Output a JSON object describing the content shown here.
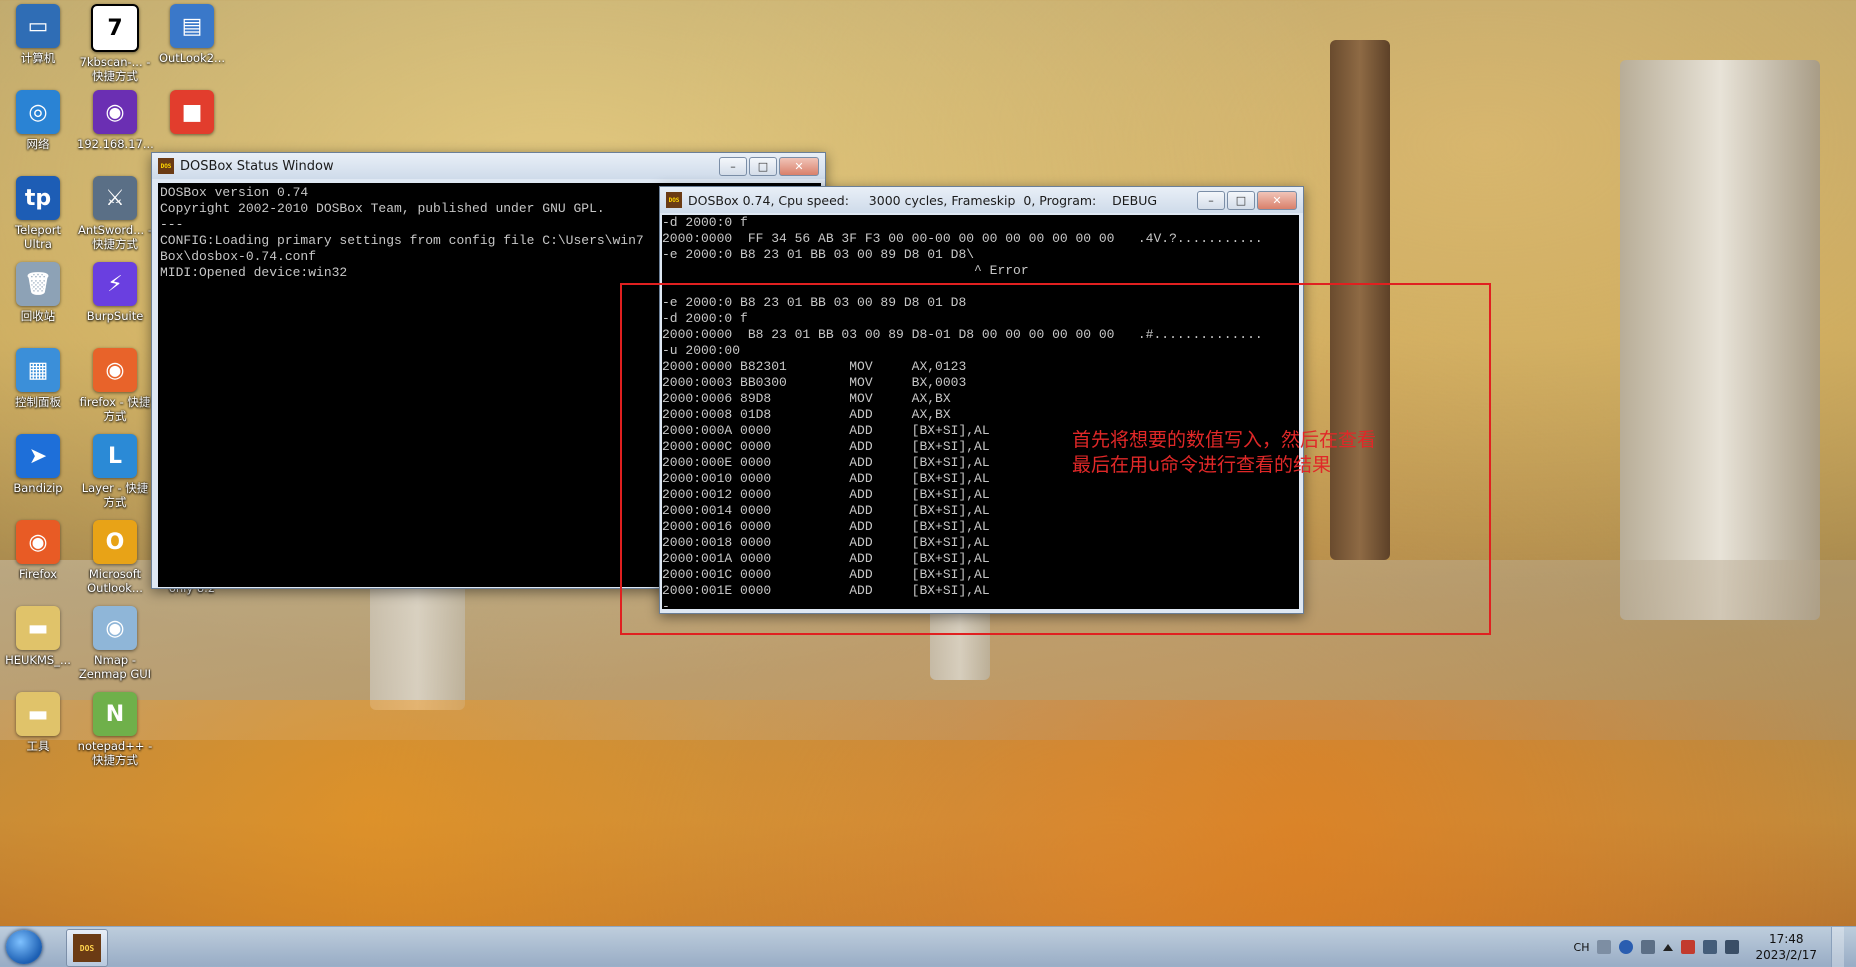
{
  "desktop_icons": [
    {
      "label": "计算机",
      "icon": "computer-icon",
      "color": "#2f6db5"
    },
    {
      "label": "7kbscan-... - 快捷方式",
      "icon": "seven-icon",
      "color": "#ffffff"
    },
    {
      "label": "OutLook2...",
      "icon": "network-pc-icon",
      "color": "#3a78c9"
    },
    {
      "label": "网络",
      "icon": "network-icon",
      "color": "#2a83d4"
    },
    {
      "label": "192.168.17...",
      "icon": "firefox-icon",
      "color": "#6b2fb3"
    },
    {
      "label": "",
      "icon": "windows-logo-icon",
      "color": "#e23d2d"
    },
    {
      "label": "Teleport Ultra",
      "icon": "teleport-icon",
      "color": "#1d5db5"
    },
    {
      "label": "AntSword... - 快捷方式",
      "icon": "antsword-icon",
      "color": "#5a6f86"
    },
    {
      "label": "回收站",
      "icon": "recycle-bin-icon",
      "color": "#8da2b6"
    },
    {
      "label": "BurpSuite",
      "icon": "burpsuite-icon",
      "color": "#6a3fe0"
    },
    {
      "label": "控制面板",
      "icon": "control-panel-icon",
      "color": "#3b8fd9"
    },
    {
      "label": "firefox - 快捷方式",
      "icon": "firefox-icon",
      "color": "#e8632a"
    },
    {
      "label": "Bandizip",
      "icon": "bandizip-icon",
      "color": "#1e6fd9"
    },
    {
      "label": "Layer - 快捷方式",
      "icon": "layer-icon",
      "color": "#2b8ad6"
    },
    {
      "label": "Firefox",
      "icon": "firefox-icon",
      "color": "#e85b25"
    },
    {
      "label": "Microsoft Outlook...",
      "icon": "outlook-icon",
      "color": "#e8a317"
    },
    {
      "label": "gVim Read only 8.2",
      "icon": "vim-icon",
      "color": "#2a8a2a"
    },
    {
      "label": "HEUKMS_...",
      "icon": "folder-icon",
      "color": "#e0c36a"
    },
    {
      "label": "Nmap - Zenmap GUI",
      "icon": "nmap-icon",
      "color": "#8fb6d8"
    },
    {
      "label": "工具",
      "icon": "folder-icon",
      "color": "#e0c36a"
    },
    {
      "label": "notepad++ - 快捷方式",
      "icon": "notepadpp-icon",
      "color": "#6fb04a"
    }
  ],
  "status_window": {
    "title": "DOSBox Status Window",
    "lines": [
      "DOSBox version 0.74",
      "Copyright 2002-2010 DOSBox Team, published under GNU GPL.",
      "---",
      "CONFIG:Loading primary settings from config file C:\\Users\\win7",
      "Box\\dosbox-0.74.conf",
      "MIDI:Opened device:win32"
    ]
  },
  "dosbox_window": {
    "title": "DOSBox 0.74, Cpu speed:     3000 cycles, Frameskip  0, Program:    DEBUG",
    "lines": [
      "-d 2000:0 f",
      "2000:0000  FF 34 56 AB 3F F3 00 00-00 00 00 00 00 00 00 00   .4V.?...........",
      "-e 2000:0 B8 23 01 BB 03 00 89 D8 01 D8\\",
      "                                        ^ Error",
      "",
      "-e 2000:0 B8 23 01 BB 03 00 89 D8 01 D8",
      "-d 2000:0 f",
      "2000:0000  B8 23 01 BB 03 00 89 D8-01 D8 00 00 00 00 00 00   .#..............",
      "-u 2000:00",
      "2000:0000 B82301        MOV     AX,0123",
      "2000:0003 BB0300        MOV     BX,0003",
      "2000:0006 89D8          MOV     AX,BX",
      "2000:0008 01D8          ADD     AX,BX",
      "2000:000A 0000          ADD     [BX+SI],AL",
      "2000:000C 0000          ADD     [BX+SI],AL",
      "2000:000E 0000          ADD     [BX+SI],AL",
      "2000:0010 0000          ADD     [BX+SI],AL",
      "2000:0012 0000          ADD     [BX+SI],AL",
      "2000:0014 0000          ADD     [BX+SI],AL",
      "2000:0016 0000          ADD     [BX+SI],AL",
      "2000:0018 0000          ADD     [BX+SI],AL",
      "2000:001A 0000          ADD     [BX+SI],AL",
      "2000:001C 0000          ADD     [BX+SI],AL",
      "2000:001E 0000          ADD     [BX+SI],AL",
      "-_"
    ]
  },
  "annotation": {
    "line1": "首先将想要的数值写入，然后在查看",
    "line2": "最后在用u命令进行查看的结果",
    "color": "#e02020"
  },
  "taskbar": {
    "app_label": "DOS",
    "language": "CH",
    "time": "17:48",
    "date": "2023/2/17"
  }
}
